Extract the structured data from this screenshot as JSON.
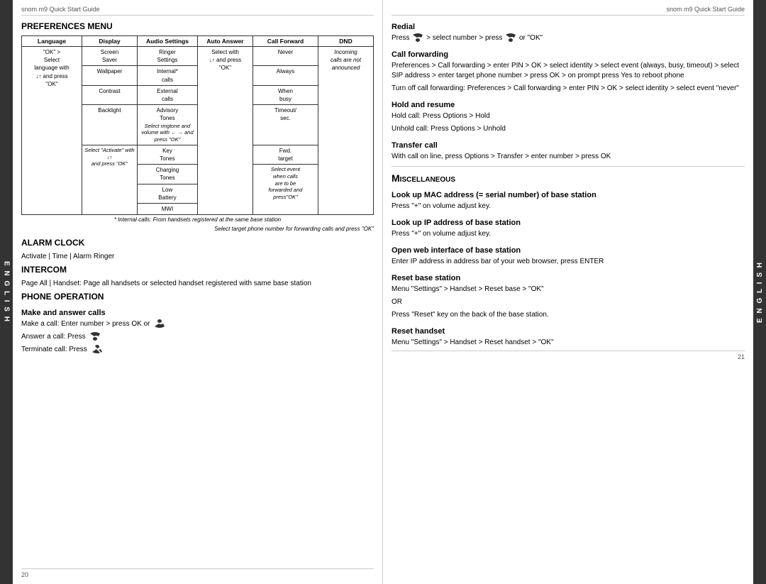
{
  "leftHeader": "snom m9 Quick Start Guide",
  "rightHeader": "snom m9 Quick Start Guide",
  "leftPageNum": "20",
  "rightPageNum": "21",
  "sideTabLeft": "E N G L I S H",
  "sideTabRight": "E N G L I S H",
  "preferencesMenu": {
    "title": "Preferences Menu",
    "columns": [
      "Language",
      "Display",
      "Audio Settings",
      "Auto Answer",
      "Call Forward",
      "DND"
    ],
    "langItems": [
      "\"OK\" >\nSelect\nlanguage with\n↓↑ and press\n\"OK\""
    ],
    "displayItems": [
      "Screen\nSaver",
      "Wallpaper",
      "Contrast",
      "Backlight"
    ],
    "audioItems": [
      "Ringer\nSettings",
      "Internal*\ncalls",
      "External\ncalls",
      "Advisory\nTones",
      "Key\nTones",
      "Charging\nTones",
      "Low\nBattery",
      "MWI"
    ],
    "autoAnswerItems": [
      "Select with\n↓↑ and press\n\"OK\""
    ],
    "callForwardItems": [
      "Never",
      "Always",
      "When\nbusy",
      "Timeout/\nsec.",
      "Fwd.\ntarget"
    ],
    "dndItems": [
      "Incoming\ncalls are not\nannounced"
    ],
    "selectRingtonNote": "Select ringtone and volume\nwith ← → and\npress \"OK\"",
    "selectActivateNote": "Select \"Activate\" with ↓↑\nand press \"OK\"",
    "internalCallsNote": "* Internal calls: From\nhandsets registered at the\nsame base station",
    "selectEventNote": "Select event\nwhen calls\nare to be\nforwarded and\npress\"OK\"",
    "selectTargetNote": "Select target\nphone number\nfor forwarding\ncalls and press\n\"OK\""
  },
  "alarmClock": {
    "title": "Alarm Clock",
    "body": "Activate | Time | Alarm Ringer"
  },
  "intercom": {
    "title": "Intercom",
    "body": "Page All |  Handset:  Page all handsets or selected handset registered with same base station"
  },
  "phoneOperation": {
    "title": "Phone Operation",
    "makeAnswer": {
      "title": "Make and answer calls",
      "line1": "Make a call:  Enter number > press OK or",
      "line2": "Answer a call:  Press",
      "line3": "Terminate call:  Press"
    }
  },
  "redial": {
    "title": "Redial",
    "body": "Press     > select number  > press     or \"OK\""
  },
  "callForwarding": {
    "title": "Call forwarding",
    "body1": "Preferences > Call forwarding > enter PIN > OK > select identity > select event (always, busy, timeout) > select SIP address > enter target phone number > press OK > on prompt press Yes to reboot phone",
    "body2": "Turn off call forwarding:  Preferences > Call forwarding > enter PIN > OK > select identity > select event \"never\""
  },
  "holdResume": {
    "title": "Hold and resume",
    "body1": "Hold call:  Press Options > Hold",
    "body2": "Unhold call:  Press Options > Unhold"
  },
  "transferCall": {
    "title": "Transfer call",
    "body": "With call on line, press Options > Transfer > enter number > press OK"
  },
  "miscellaneous": {
    "title": "Miscellaneous",
    "macAddress": {
      "title": "Look up MAC address (= serial number) of base station",
      "body": "Press \"+\" on volume adjust key."
    },
    "ipAddress": {
      "title": "Look up IP address of base station",
      "body": "Press \"+\" on volume adjust key."
    },
    "webInterface": {
      "title": "Open web interface of base station",
      "body": "Enter IP address in address bar of your web browser, press ENTER"
    },
    "resetBase": {
      "title": "Reset base station",
      "line1": "Menu \"Settings\"  >  Handset  >  Reset base >  \"OK\"",
      "line2": "OR",
      "line3": "Press \"Reset\" key on the back of the base station."
    },
    "resetHandset": {
      "title": "Reset handset",
      "body": "Menu \"Settings\"  >  Handset  >  Reset handset >  \"OK\""
    }
  }
}
